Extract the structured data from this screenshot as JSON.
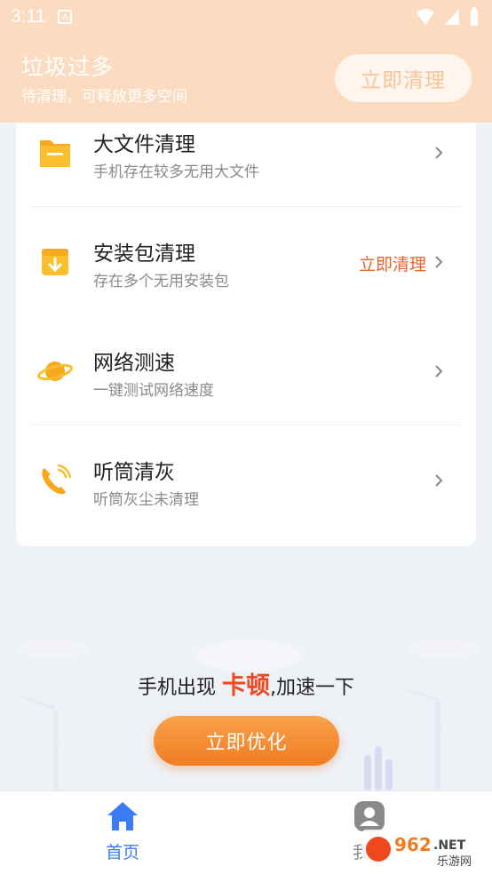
{
  "status_bar": {
    "time": "3:11",
    "notif_icon": "A"
  },
  "header": {
    "title": "垃圾过多",
    "subtitle": "待清理，可释放更多空间",
    "button_label": "立即清理"
  },
  "list": [
    {
      "title": "大文件清理",
      "desc": "手机存在较多无用大文件",
      "icon": "folder-icon",
      "action": ""
    },
    {
      "title": "安装包清理",
      "desc": "存在多个无用安装包",
      "icon": "package-icon",
      "action": "立即清理"
    },
    {
      "title": "网络测速",
      "desc": "一键测试网络速度",
      "icon": "planet-icon",
      "action": ""
    },
    {
      "title": "听筒清灰",
      "desc": "听筒灰尘未清理",
      "icon": "phone-icon",
      "action": ""
    }
  ],
  "promo": {
    "text_before": "手机出现 ",
    "text_highlight": "卡顿",
    "text_after": ",加速一下",
    "button_label": "立即优化"
  },
  "nav": {
    "home_label": "首页",
    "mine_label": "我的"
  },
  "watermark": {
    "text1": "962",
    "text2": ".NET",
    "text3": "乐游网"
  },
  "colors": {
    "header_bg": "#fcdcc0",
    "accent_orange": "#f07c22",
    "highlight_red": "#f0481e",
    "nav_active": "#3b7cf2"
  }
}
